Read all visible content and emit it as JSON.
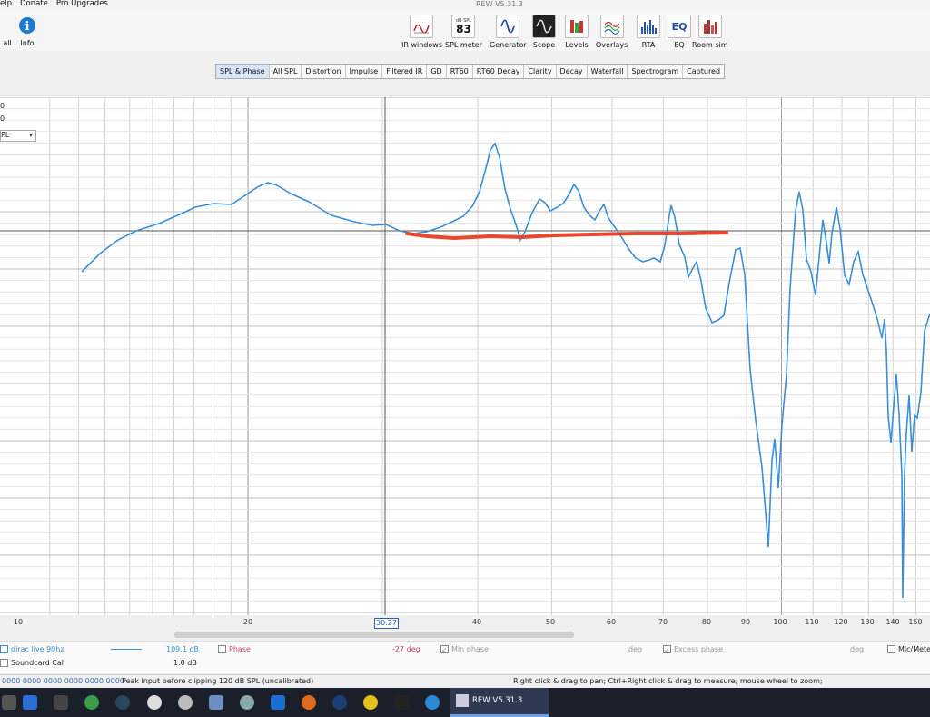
{
  "window": {
    "title": "REW V5.31.3"
  },
  "menu": [
    "elp",
    "Donate",
    "Pro Upgrades"
  ],
  "toolbar": {
    "left": [
      {
        "label": "all",
        "icon": "all-icon"
      },
      {
        "label": "Info",
        "icon": "info-icon"
      }
    ],
    "right": [
      {
        "label": "IR windows",
        "icon": "ir-windows-icon"
      },
      {
        "label": "SPL meter",
        "icon": "spl-meter-icon",
        "readout_top": "dB SPL",
        "readout": "83"
      },
      {
        "label": "Generator",
        "icon": "generator-icon"
      },
      {
        "label": "Scope",
        "icon": "scope-icon"
      },
      {
        "label": "Levels",
        "icon": "levels-icon"
      },
      {
        "label": "Overlays",
        "icon": "overlays-icon"
      },
      {
        "label": "RTA",
        "icon": "rta-icon"
      },
      {
        "label": "EQ",
        "icon": "eq-icon"
      },
      {
        "label": "Room sim",
        "icon": "room-sim-icon"
      }
    ]
  },
  "tabs": [
    "SPL & Phase",
    "All SPL",
    "Distortion",
    "Impulse",
    "Filtered IR",
    "GD",
    "RT60",
    "RT60 Decay",
    "Clarity",
    "Decay",
    "Waterfall",
    "Spectrogram",
    "Captured"
  ],
  "active_tab": "SPL & Phase",
  "graph_controls": {
    "row1": "0",
    "row2": "0",
    "select": "PL"
  },
  "chart_data": {
    "type": "line",
    "x_scale": "log",
    "x_ticks": [
      "10",
      "20",
      "30.27",
      "40",
      "50",
      "60",
      "70",
      "80",
      "90",
      "100",
      "110",
      "120",
      "130",
      "140",
      "150"
    ],
    "cursor_x": "30.27",
    "series": [
      {
        "name": "dirac live 90hz",
        "color": "#3a8fd6"
      }
    ],
    "annotation_color": "#e8472e",
    "grid": true
  },
  "legend": {
    "trace_name": "dirac live 90hz",
    "trace_value": "109.1 dB",
    "soundcard": "Soundcard Cal",
    "soundcard_value": "1.0 dB",
    "phase_label": "Phase",
    "phase_value": "-27 deg",
    "min_phase": "Min phase",
    "min_phase_unit": "deg",
    "excess_phase": "Excess phase",
    "excess_phase_unit": "deg",
    "mic_meter": "Mic/Mete"
  },
  "status": {
    "hex": "0000 0000 0000 0000 0000 0000",
    "peak": "Peak input before clipping 120 dB SPL (uncalibrated)",
    "hint": "Right click & drag to pan; Ctrl+Right click & drag to measure; mouse wheel to zoom;"
  },
  "taskbar": {
    "active_app": "REW V5.31.3"
  }
}
